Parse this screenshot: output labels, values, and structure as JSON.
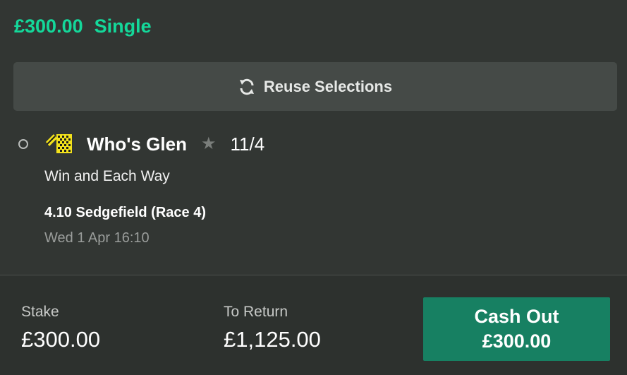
{
  "bet": {
    "amount": "£300.00",
    "type": "Single"
  },
  "reuse_button": {
    "label": "Reuse Selections",
    "icon": "refresh-icon"
  },
  "selection": {
    "runner": "Who's Glen",
    "odds": "11/4",
    "market": "Win and Each Way",
    "event": "4.10 Sedgefield (Race 4)",
    "datetime": "Wed 1 Apr 16:10",
    "silks_colors": [
      "#f3e21b",
      "#1c1c1c"
    ]
  },
  "footer": {
    "stake_label": "Stake",
    "stake_value": "£300.00",
    "return_label": "To Return",
    "return_value": "£1,125.00",
    "cashout_label": "Cash Out",
    "cashout_value": "£300.00"
  },
  "colors": {
    "accent": "#14d89a",
    "background": "#323633",
    "button": "#454a47",
    "cashout": "#178062"
  }
}
